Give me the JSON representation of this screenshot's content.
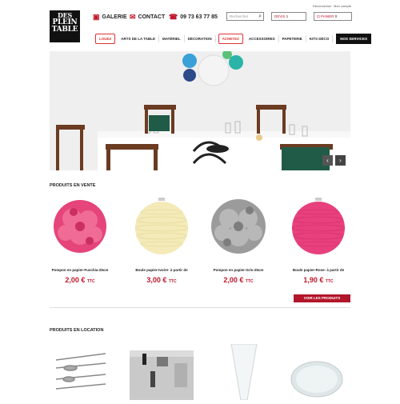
{
  "header": {
    "logo_line1": "DES",
    "logo_line2": "PLEIN",
    "logo_line3": "TABLE",
    "galerie": "GALERIE",
    "contact": "CONTACT",
    "phone": "09 73 63 77 85",
    "search_placeholder": "Rechercher",
    "devis_label": "DEVIS",
    "devis_count": "1",
    "panier_label": "PANIER",
    "panier_count": "0",
    "deconnexion": "Déconnexion",
    "mon_compte": "Mon compte"
  },
  "nav": {
    "louez": "LOUEZ",
    "arts": "ARTS DE LA TABLE",
    "materiel": "MATÉRIEL",
    "decoration": "DÉCORATION",
    "achetez": "ACHETEZ",
    "accessoires": "ACCESSOIRES",
    "papeterie": "PAPETERIE",
    "kits": "KITS DÉCO",
    "services": "NOS SERVICES"
  },
  "hero": {
    "prev": "‹",
    "next": "›"
  },
  "vente": {
    "title": "PRODUITS EN VENTE",
    "products": [
      {
        "name": "Pompon en papier-Fuschia-25cm",
        "price": "2,00 €",
        "ttc": "TTC",
        "color": "#e5457a"
      },
      {
        "name": "Boule papier-Ivoire- à partir de",
        "price": "3,00 €",
        "ttc": "TTC",
        "color": "#f3eab8"
      },
      {
        "name": "Pompon en papier-Gris-25cm",
        "price": "2,00 €",
        "ttc": "TTC",
        "color": "#9b9b9b"
      },
      {
        "name": "Boule papier-Rose- à partir de",
        "price": "1,90 €",
        "ttc": "TTC",
        "color": "#e8407d"
      }
    ],
    "voir_prefix": "VOIR LES",
    "voir_suffix": "PRODUITS"
  },
  "location": {
    "title": "PRODUITS EN LOCATION"
  }
}
